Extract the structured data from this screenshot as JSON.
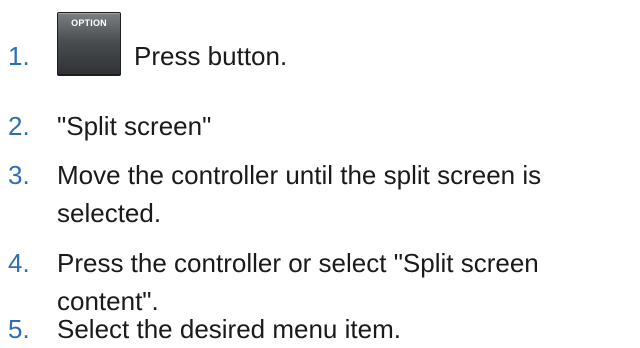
{
  "steps": [
    {
      "number": "1.",
      "text": "Press button.",
      "icon": "option-button-icon",
      "icon_label": "OPTION"
    },
    {
      "number": "2.",
      "text": "\"Split screen\""
    },
    {
      "number": "3.",
      "text": "Move the controller until the split screen is selected."
    },
    {
      "number": "4.",
      "text": "Press the controller or select \"Split screen content\"."
    },
    {
      "number": "5.",
      "text": "Select the desired menu item."
    }
  ],
  "colors": {
    "step_number": "#2d6fb3",
    "body_text": "#1a1a1a",
    "button_face": "#4b4e51"
  }
}
